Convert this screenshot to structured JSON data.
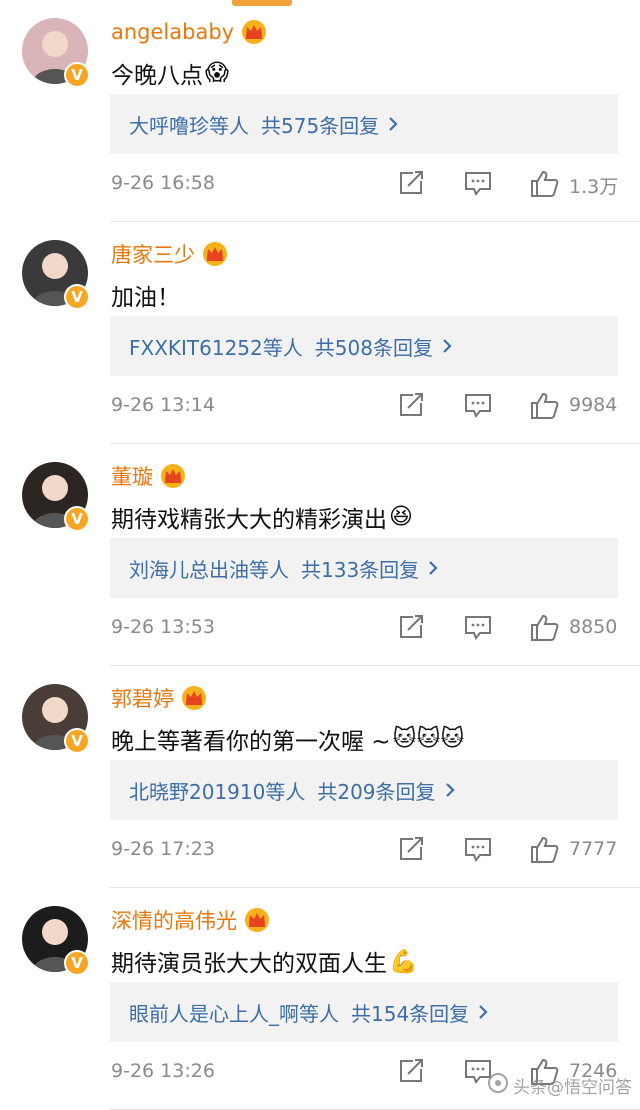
{
  "comments": [
    {
      "username": "angelababy",
      "text": "今晚八点",
      "emoji": "scream-face",
      "reply_users": "大呼噜珍等人",
      "reply_count": "共575条回复",
      "timestamp": "9-26 16:58",
      "likes": "1.3万",
      "avatar_color": "#d9b4b8"
    },
    {
      "username": "唐家三少",
      "text": "加油！",
      "emoji": "",
      "reply_users": "FXXKIT61252等人",
      "reply_count": "共508条回复",
      "timestamp": "9-26 13:14",
      "likes": "9984",
      "avatar_color": "#3a3a3a"
    },
    {
      "username": "董璇",
      "text": "期待戏精张大大的精彩演出",
      "emoji": "grinning-face",
      "reply_users": "刘海儿总出油等人",
      "reply_count": "共133条回复",
      "timestamp": "9-26 13:53",
      "likes": "8850",
      "avatar_color": "#2b2622"
    },
    {
      "username": "郭碧婷",
      "text": "晚上等著看你的第一次喔 ~",
      "emoji": "doraemon-face x3",
      "reply_users": "北晓野201910等人",
      "reply_count": "共209条回复",
      "timestamp": "9-26 17:23",
      "likes": "7777",
      "avatar_color": "#4a3c36"
    },
    {
      "username": "深情的高伟光",
      "text": "期待演员张大大的双面人生",
      "emoji": "flexed-biceps",
      "reply_users": "眼前人是心上人_啊等人",
      "reply_count": "共154条回复",
      "timestamp": "9-26 13:26",
      "likes": "7246",
      "avatar_color": "#1c1c1c"
    }
  ],
  "icons": {
    "crown": "crown-badge-icon",
    "verified": "verified-v-icon",
    "repost": "repost-icon",
    "reply": "comment-icon",
    "like": "thumbs-up-icon",
    "chevron": "chevron-right-icon"
  },
  "colors": {
    "username": "#e8770e",
    "link": "#3d6ea6",
    "meta": "#8a8a8a",
    "reply_bg": "#f2f2f2",
    "verified": "#f6a623"
  },
  "watermark": "头条@悟空问答"
}
